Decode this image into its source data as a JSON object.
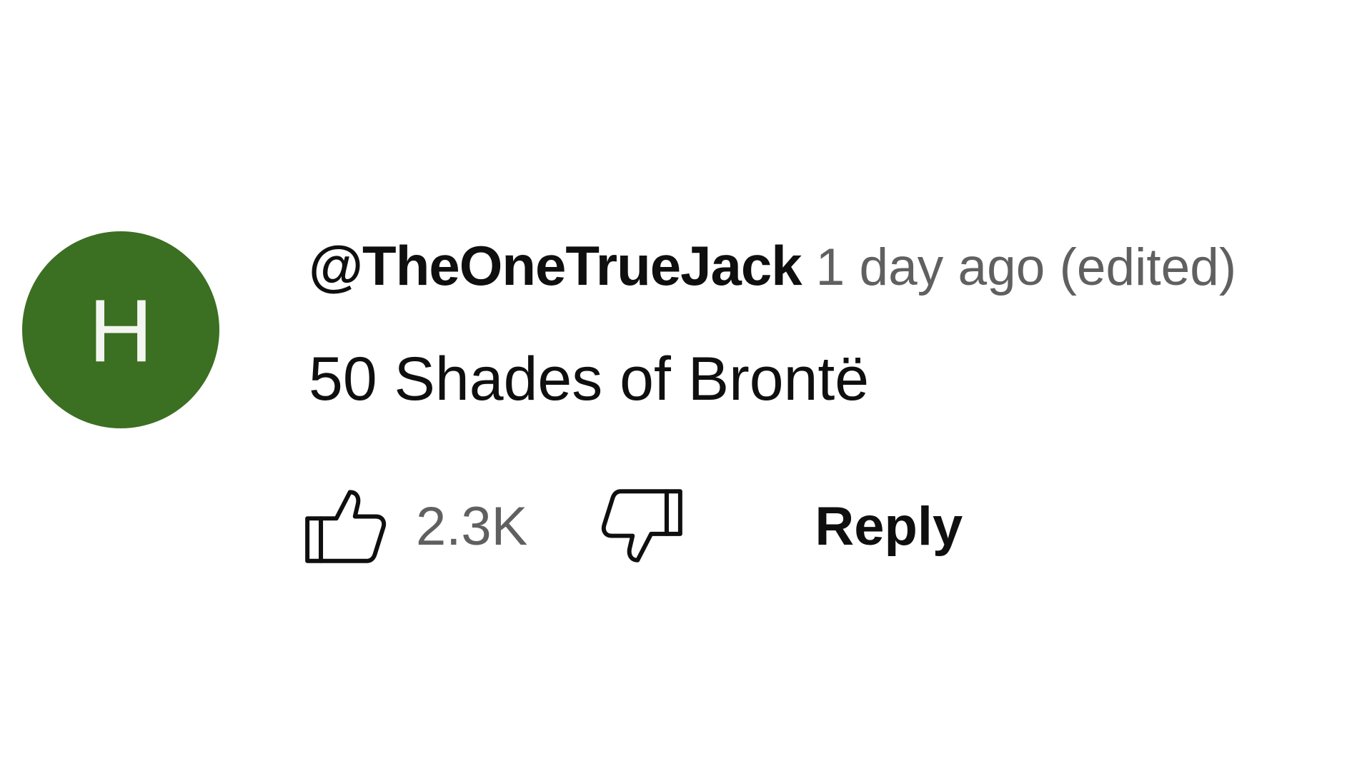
{
  "comment": {
    "avatar": {
      "letter": "H",
      "color": "#3b6f22"
    },
    "author": "@TheOneTrueJack",
    "timestamp": "1 day ago (edited)",
    "text": "50 Shades of Brontë",
    "like_count": "2.3K",
    "reply_label": "Reply",
    "icons": {
      "like": "thumbs-up-icon",
      "dislike": "thumbs-down-icon"
    }
  }
}
